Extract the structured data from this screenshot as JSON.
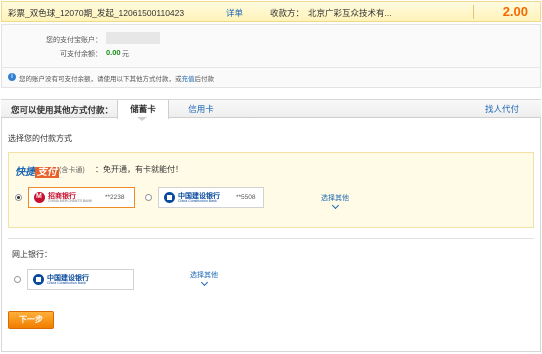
{
  "order": {
    "title": "彩票_双色球_12070期_发起_12061500110423",
    "detail_link": "详单",
    "payee_label": "收款方：",
    "payee": "北京广彩互众技术有...",
    "amount": "2.00"
  },
  "account": {
    "alipay_label": "您的支付宝账户：",
    "balance_label": "可支付余额：",
    "balance_value": "0.00",
    "balance_unit": "元",
    "notice_prefix": "您的账户没有可支付余额，请使用以下其他方式付款，或",
    "notice_link": "充值",
    "notice_suffix": "后付款"
  },
  "tabs": {
    "label": "您可以使用其他方式付款：",
    "items": [
      {
        "label": "储蓄卡",
        "active": true
      },
      {
        "label": "信用卡",
        "active": false
      },
      {
        "label": "找人代付",
        "active": false
      }
    ]
  },
  "payment": {
    "section_title": "选择您的付款方式",
    "quick": {
      "logo_a": "快捷",
      "logo_b": "支付",
      "sub": "(含卡通)",
      "slogan": "：免开通，有卡就能付！",
      "cards": [
        {
          "bank": "招商银行",
          "bank_en": "CHINA MERCHANTS BANK",
          "number": "**2238",
          "selected": true
        },
        {
          "bank": "中国建设银行",
          "bank_en": "China Construction Bank",
          "number": "**5508",
          "selected": false
        }
      ],
      "choose_other": "选择其他"
    },
    "online": {
      "title": "网上银行：",
      "bank": "中国建设银行",
      "bank_en": "China Construction Bank",
      "choose_other": "选择其他"
    },
    "next_button": "下一步"
  },
  "colors": {
    "accent_orange": "#f26a00",
    "link_blue": "#1a66b3",
    "balance_green": "#1a8f1a",
    "cmb_red": "#c8102e",
    "ccb_blue": "#0a4a9e"
  }
}
